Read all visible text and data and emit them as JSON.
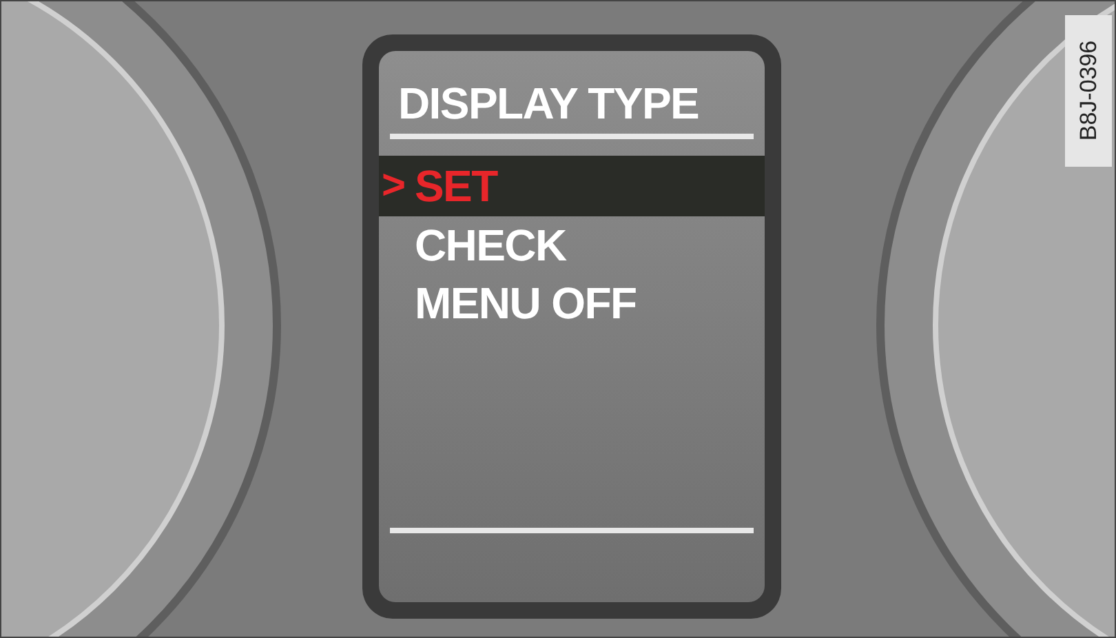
{
  "display": {
    "title": "DISPLAY TYPE",
    "cursor": ">",
    "items": [
      {
        "label": "SET",
        "selected": true
      },
      {
        "label": "CHECK",
        "selected": false
      },
      {
        "label": "MENU OFF",
        "selected": false
      }
    ]
  },
  "figure_code": "B8J-0396"
}
